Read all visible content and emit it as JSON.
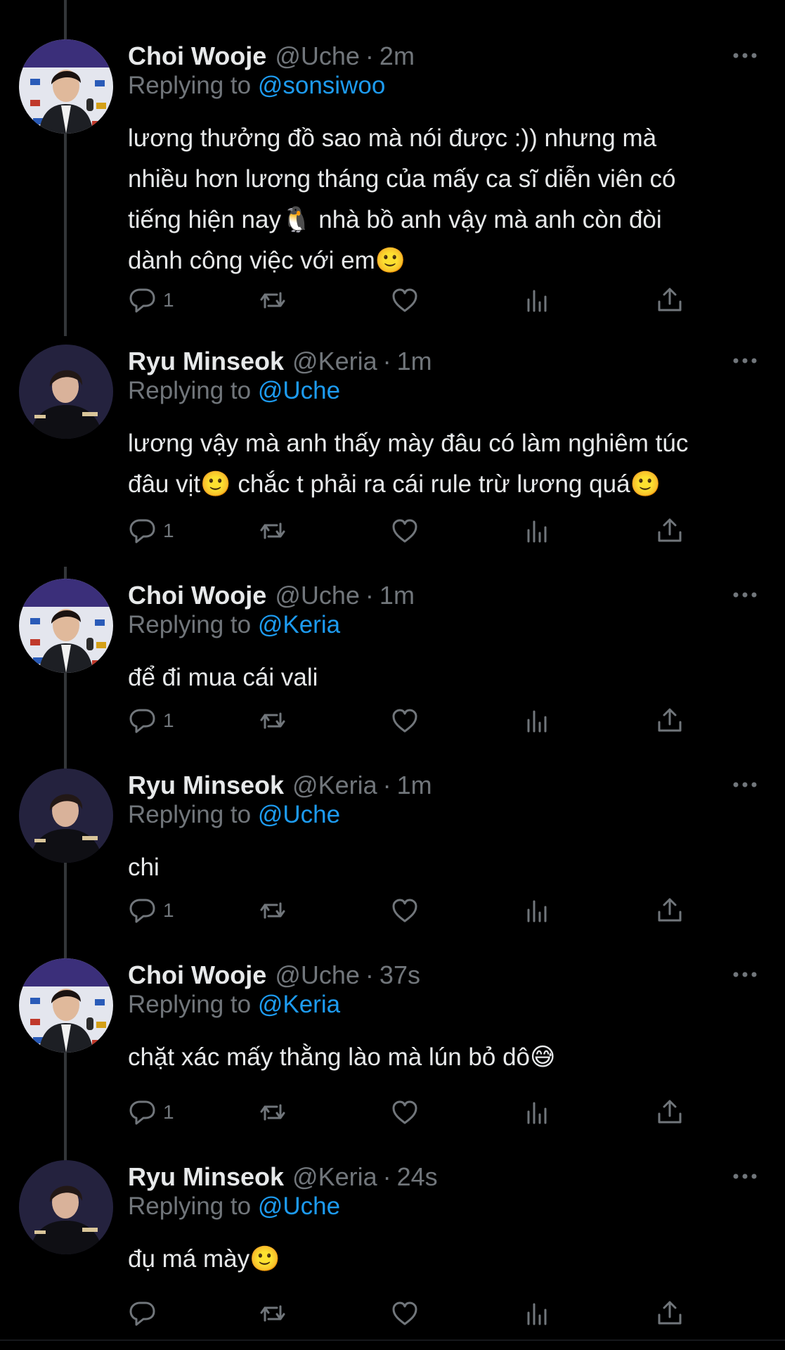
{
  "tweets": [
    {
      "name": "Choi Wooje",
      "handle": "@Uche",
      "dot": "·",
      "time": "2m",
      "replying_label": "Replying to",
      "replying_to": "@sonsiwoo",
      "lines": [
        "lương thưởng đồ sao mà nói được :)) nhưng mà",
        "nhiều hơn lương tháng của mấy ca sĩ diễn viên có",
        "tiếng hiện nay🐧  nhà bồ anh vậy mà anh còn đòi",
        "dành công việc với em🙂"
      ],
      "reply_count": "1",
      "avatar": "wooje"
    },
    {
      "name": "Ryu Minseok",
      "handle": "@Keria",
      "dot": "·",
      "time": "1m",
      "replying_label": "Replying to",
      "replying_to": "@Uche",
      "lines": [
        "lương vậy mà anh thấy mày đâu có làm nghiêm túc",
        "đâu vịt🙂  chắc t phải ra cái rule trừ lương quá🙂"
      ],
      "reply_count": "1",
      "avatar": "minseok"
    },
    {
      "name": "Choi Wooje",
      "handle": "@Uche",
      "dot": "·",
      "time": "1m",
      "replying_label": "Replying to",
      "replying_to": "@Keria",
      "lines": [
        "để đi mua cái vali"
      ],
      "reply_count": "1",
      "avatar": "wooje"
    },
    {
      "name": "Ryu Minseok",
      "handle": "@Keria",
      "dot": "·",
      "time": "1m",
      "replying_label": "Replying to",
      "replying_to": "@Uche",
      "lines": [
        "chi"
      ],
      "reply_count": "1",
      "avatar": "minseok"
    },
    {
      "name": "Choi Wooje",
      "handle": "@Uche",
      "dot": "·",
      "time": "37s",
      "replying_label": "Replying to",
      "replying_to": "@Keria",
      "lines": [
        "chặt xác mấy thằng lào mà lún bỏ dô😅"
      ],
      "reply_count": "1",
      "avatar": "wooje"
    },
    {
      "name": "Ryu Minseok",
      "handle": "@Keria",
      "dot": "·",
      "time": "24s",
      "replying_label": "Replying to",
      "replying_to": "@Uche",
      "lines": [
        "đụ má mày🙂"
      ],
      "reply_count": "",
      "avatar": "minseok"
    }
  ],
  "icons": {
    "more": "more-options-icon",
    "reply": "reply-icon",
    "retweet": "retweet-icon",
    "like": "like-icon",
    "views": "views-icon",
    "share": "share-icon"
  },
  "colors": {
    "background": "#000000",
    "text": "#e7e9ea",
    "muted": "#71767b",
    "link": "#1d9bf0",
    "thread_line": "#333639"
  }
}
